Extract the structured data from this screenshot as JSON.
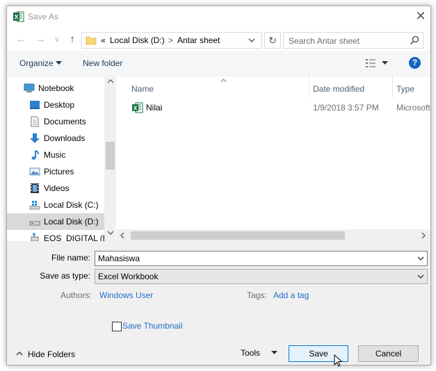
{
  "window": {
    "title": "Save As",
    "app_icon": "excel-icon",
    "close_glyph": "✕"
  },
  "nav": {
    "back_glyph": "←",
    "forward_glyph": "→",
    "recent_glyph": "∨",
    "up_glyph": "↑",
    "breadcrumb_sep": "«",
    "path": [
      "Local Disk (D:)",
      "Antar sheet"
    ],
    "path_sep": ">",
    "refresh_glyph": "↻",
    "search_placeholder": "Search Antar sheet"
  },
  "toolbar": {
    "organize_label": "Organize",
    "new_folder_label": "New folder",
    "help_glyph": "?"
  },
  "sidebar": {
    "items": [
      {
        "label": "Notebook",
        "icon": "computer-icon"
      },
      {
        "label": "Desktop",
        "icon": "desktop-icon"
      },
      {
        "label": "Documents",
        "icon": "documents-icon"
      },
      {
        "label": "Downloads",
        "icon": "download-icon"
      },
      {
        "label": "Music",
        "icon": "music-icon"
      },
      {
        "label": "Pictures",
        "icon": "pictures-icon"
      },
      {
        "label": "Videos",
        "icon": "videos-icon"
      },
      {
        "label": "Local Disk (C:)",
        "icon": "windows-drive-icon"
      },
      {
        "label": "Local Disk (D:)",
        "icon": "drive-icon",
        "selected": true
      },
      {
        "label": "EOS_DIGITAL (E:)",
        "icon": "usb-drive-icon"
      }
    ]
  },
  "file_list": {
    "columns": [
      "Name",
      "Date modified",
      "Type"
    ],
    "files": [
      {
        "name": "Nilai",
        "date_modified": "1/9/2018 3:57 PM",
        "type": "Microsoft",
        "icon": "excel-file-icon"
      }
    ]
  },
  "form": {
    "file_name_label": "File name:",
    "file_name_value": "Mahasiswa",
    "save_type_label": "Save as type:",
    "save_type_value": "Excel Workbook",
    "authors_label": "Authors:",
    "authors_value": "Windows User",
    "tags_label": "Tags:",
    "tags_value": "Add a tag",
    "thumbnail_label": "Save Thumbnail",
    "thumbnail_checked": false
  },
  "footer": {
    "hide_folders_label": "Hide Folders",
    "tools_label": "Tools",
    "save_label": "Save",
    "cancel_label": "Cancel"
  },
  "colors": {
    "accent": "#0078d7",
    "link": "#1e6ec9",
    "excel_green": "#1d7044",
    "help_blue": "#1565c0"
  }
}
